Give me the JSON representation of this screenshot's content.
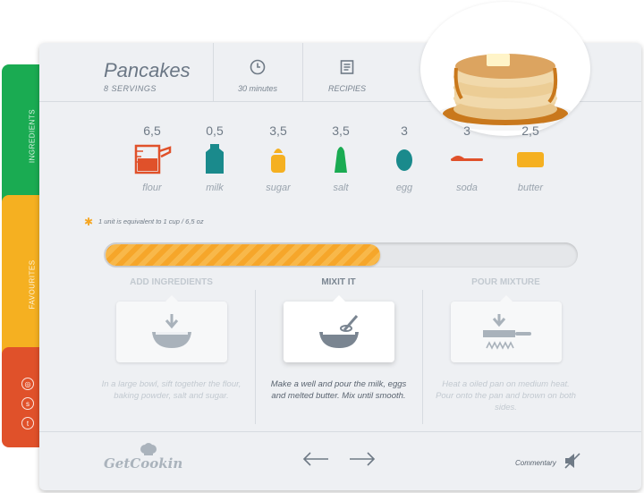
{
  "sidebar": {
    "tabs": [
      {
        "label": "INGREDIENTS",
        "color": "#1aab52"
      },
      {
        "label": "FAVOURITES",
        "color": "#f5b021"
      },
      {
        "label": "",
        "color": "#e0512a"
      }
    ],
    "social": [
      "dribbble-icon",
      "skype-icon",
      "twitter-icon"
    ]
  },
  "header": {
    "title": "Pancakes",
    "servings": "8 SERVINGS",
    "time": "30 minutes",
    "recipies": "RECIPIES"
  },
  "ingredients": [
    {
      "value": "6,5",
      "name": "flour",
      "color": "#e0512a"
    },
    {
      "value": "0,5",
      "name": "milk",
      "color": "#1a8a8c"
    },
    {
      "value": "3,5",
      "name": "sugar",
      "color": "#f5b021"
    },
    {
      "value": "3,5",
      "name": "salt",
      "color": "#1aab52"
    },
    {
      "value": "3",
      "name": "egg",
      "color": "#1a8a8c"
    },
    {
      "value": "3",
      "name": "soda",
      "color": "#e0512a"
    },
    {
      "value": "2,5",
      "name": "butter",
      "color": "#f5b021"
    }
  ],
  "note": "1 unit is equivalent to 1 cup / 6,5 oz",
  "progress": {
    "fraction": 0.58,
    "color": "#f6a62a"
  },
  "steps": [
    {
      "title": "ADD INGREDIENTS",
      "desc": "In a large bowl, sift together the flour, baking powder, salt and sugar.",
      "icon": "bowl-arrow-icon",
      "active": false
    },
    {
      "title": "MIXIT IT",
      "desc": "Make a well and pour the milk, eggs and melted butter. Mix until smooth.",
      "icon": "whisk-bowl-icon",
      "active": true
    },
    {
      "title": "POUR MIXTURE",
      "desc": "Heat a oiled pan on medium heat. Pour onto the pan and brown on both sides.",
      "icon": "pan-icon",
      "active": false
    }
  ],
  "footer": {
    "logo": "GetCookin",
    "commentary": "Commentary"
  }
}
